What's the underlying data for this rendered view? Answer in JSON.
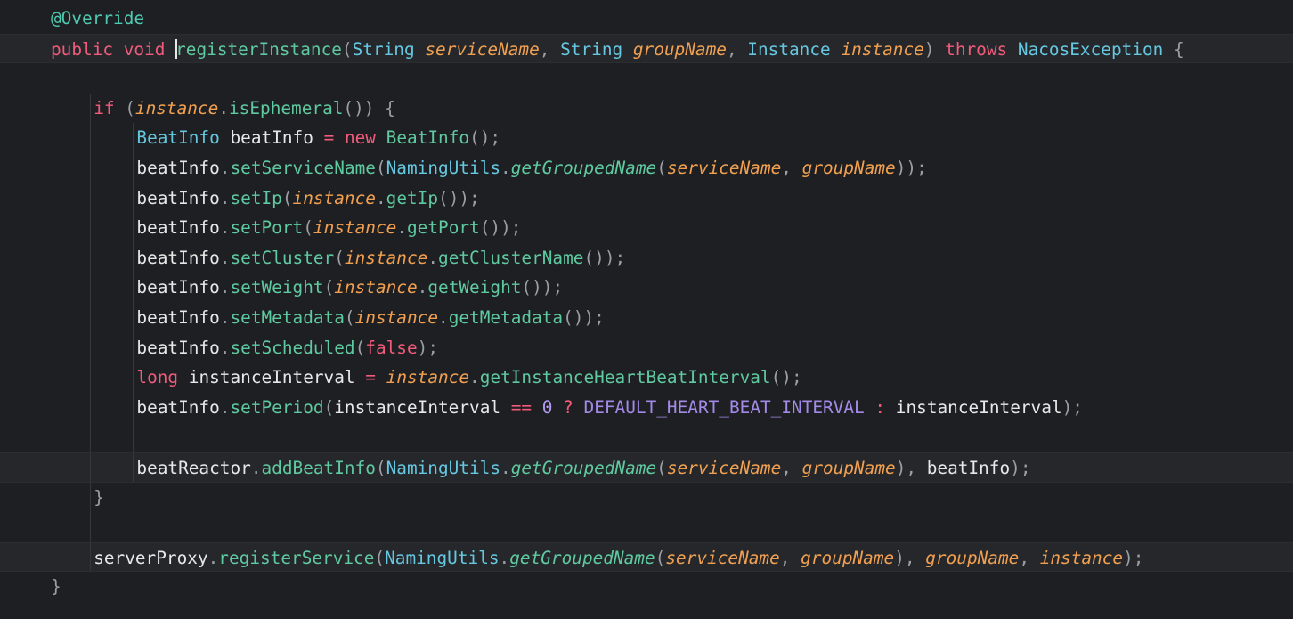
{
  "editor": {
    "language": "java",
    "lines": [
      {
        "indent": 0,
        "tokens": [
          {
            "t": "@Override",
            "c": "annot"
          }
        ]
      },
      {
        "indent": 0,
        "highlight": true,
        "caret_after_token": 4,
        "tokens": [
          {
            "t": "public",
            "c": "kw"
          },
          {
            "t": " ",
            "c": "pun"
          },
          {
            "t": "void",
            "c": "kw"
          },
          {
            "t": " ",
            "c": "pun"
          },
          {
            "t": "registerInstance",
            "c": "fn"
          },
          {
            "t": "(",
            "c": "pun"
          },
          {
            "t": "String",
            "c": "type"
          },
          {
            "t": " ",
            "c": "pun"
          },
          {
            "t": "serviceName",
            "c": "param"
          },
          {
            "t": ", ",
            "c": "pun"
          },
          {
            "t": "String",
            "c": "type"
          },
          {
            "t": " ",
            "c": "pun"
          },
          {
            "t": "groupName",
            "c": "param"
          },
          {
            "t": ", ",
            "c": "pun"
          },
          {
            "t": "Instance",
            "c": "type"
          },
          {
            "t": " ",
            "c": "pun"
          },
          {
            "t": "instance",
            "c": "param"
          },
          {
            "t": ") ",
            "c": "pun"
          },
          {
            "t": "throws",
            "c": "kw"
          },
          {
            "t": " ",
            "c": "pun"
          },
          {
            "t": "NacosException",
            "c": "type"
          },
          {
            "t": " {",
            "c": "pun"
          }
        ]
      },
      {
        "indent": 0,
        "tokens": []
      },
      {
        "indent": 1,
        "tokens": [
          {
            "t": "if",
            "c": "kw"
          },
          {
            "t": " (",
            "c": "pun"
          },
          {
            "t": "instance",
            "c": "param"
          },
          {
            "t": ".",
            "c": "pun"
          },
          {
            "t": "isEphemeral",
            "c": "fn"
          },
          {
            "t": "()) {",
            "c": "pun"
          }
        ]
      },
      {
        "indent": 2,
        "tokens": [
          {
            "t": "BeatInfo",
            "c": "type"
          },
          {
            "t": " ",
            "c": "pun"
          },
          {
            "t": "beatInfo",
            "c": "var"
          },
          {
            "t": " ",
            "c": "pun"
          },
          {
            "t": "=",
            "c": "op"
          },
          {
            "t": " ",
            "c": "pun"
          },
          {
            "t": "new",
            "c": "kw"
          },
          {
            "t": " ",
            "c": "pun"
          },
          {
            "t": "BeatInfo",
            "c": "fn"
          },
          {
            "t": "();",
            "c": "pun"
          }
        ]
      },
      {
        "indent": 2,
        "tokens": [
          {
            "t": "beatInfo",
            "c": "var"
          },
          {
            "t": ".",
            "c": "pun"
          },
          {
            "t": "setServiceName",
            "c": "fn"
          },
          {
            "t": "(",
            "c": "pun"
          },
          {
            "t": "NamingUtils",
            "c": "type"
          },
          {
            "t": ".",
            "c": "pun"
          },
          {
            "t": "getGroupedName",
            "c": "static"
          },
          {
            "t": "(",
            "c": "pun"
          },
          {
            "t": "serviceName",
            "c": "param"
          },
          {
            "t": ", ",
            "c": "pun"
          },
          {
            "t": "groupName",
            "c": "param"
          },
          {
            "t": "));",
            "c": "pun"
          }
        ]
      },
      {
        "indent": 2,
        "tokens": [
          {
            "t": "beatInfo",
            "c": "var"
          },
          {
            "t": ".",
            "c": "pun"
          },
          {
            "t": "setIp",
            "c": "fn"
          },
          {
            "t": "(",
            "c": "pun"
          },
          {
            "t": "instance",
            "c": "param"
          },
          {
            "t": ".",
            "c": "pun"
          },
          {
            "t": "getIp",
            "c": "fn"
          },
          {
            "t": "());",
            "c": "pun"
          }
        ]
      },
      {
        "indent": 2,
        "tokens": [
          {
            "t": "beatInfo",
            "c": "var"
          },
          {
            "t": ".",
            "c": "pun"
          },
          {
            "t": "setPort",
            "c": "fn"
          },
          {
            "t": "(",
            "c": "pun"
          },
          {
            "t": "instance",
            "c": "param"
          },
          {
            "t": ".",
            "c": "pun"
          },
          {
            "t": "getPort",
            "c": "fn"
          },
          {
            "t": "());",
            "c": "pun"
          }
        ]
      },
      {
        "indent": 2,
        "tokens": [
          {
            "t": "beatInfo",
            "c": "var"
          },
          {
            "t": ".",
            "c": "pun"
          },
          {
            "t": "setCluster",
            "c": "fn"
          },
          {
            "t": "(",
            "c": "pun"
          },
          {
            "t": "instance",
            "c": "param"
          },
          {
            "t": ".",
            "c": "pun"
          },
          {
            "t": "getClusterName",
            "c": "fn"
          },
          {
            "t": "());",
            "c": "pun"
          }
        ]
      },
      {
        "indent": 2,
        "tokens": [
          {
            "t": "beatInfo",
            "c": "var"
          },
          {
            "t": ".",
            "c": "pun"
          },
          {
            "t": "setWeight",
            "c": "fn"
          },
          {
            "t": "(",
            "c": "pun"
          },
          {
            "t": "instance",
            "c": "param"
          },
          {
            "t": ".",
            "c": "pun"
          },
          {
            "t": "getWeight",
            "c": "fn"
          },
          {
            "t": "());",
            "c": "pun"
          }
        ]
      },
      {
        "indent": 2,
        "tokens": [
          {
            "t": "beatInfo",
            "c": "var"
          },
          {
            "t": ".",
            "c": "pun"
          },
          {
            "t": "setMetadata",
            "c": "fn"
          },
          {
            "t": "(",
            "c": "pun"
          },
          {
            "t": "instance",
            "c": "param"
          },
          {
            "t": ".",
            "c": "pun"
          },
          {
            "t": "getMetadata",
            "c": "fn"
          },
          {
            "t": "());",
            "c": "pun"
          }
        ]
      },
      {
        "indent": 2,
        "tokens": [
          {
            "t": "beatInfo",
            "c": "var"
          },
          {
            "t": ".",
            "c": "pun"
          },
          {
            "t": "setScheduled",
            "c": "fn"
          },
          {
            "t": "(",
            "c": "pun"
          },
          {
            "t": "false",
            "c": "kw"
          },
          {
            "t": ");",
            "c": "pun"
          }
        ]
      },
      {
        "indent": 2,
        "tokens": [
          {
            "t": "long",
            "c": "kw"
          },
          {
            "t": " ",
            "c": "pun"
          },
          {
            "t": "instanceInterval",
            "c": "var"
          },
          {
            "t": " ",
            "c": "pun"
          },
          {
            "t": "=",
            "c": "op"
          },
          {
            "t": " ",
            "c": "pun"
          },
          {
            "t": "instance",
            "c": "param"
          },
          {
            "t": ".",
            "c": "pun"
          },
          {
            "t": "getInstanceHeartBeatInterval",
            "c": "fn"
          },
          {
            "t": "();",
            "c": "pun"
          }
        ]
      },
      {
        "indent": 2,
        "tokens": [
          {
            "t": "beatInfo",
            "c": "var"
          },
          {
            "t": ".",
            "c": "pun"
          },
          {
            "t": "setPeriod",
            "c": "fn"
          },
          {
            "t": "(",
            "c": "pun"
          },
          {
            "t": "instanceInterval",
            "c": "var"
          },
          {
            "t": " ",
            "c": "pun"
          },
          {
            "t": "==",
            "c": "op"
          },
          {
            "t": " ",
            "c": "pun"
          },
          {
            "t": "0",
            "c": "num"
          },
          {
            "t": " ",
            "c": "pun"
          },
          {
            "t": "?",
            "c": "op"
          },
          {
            "t": " ",
            "c": "pun"
          },
          {
            "t": "DEFAULT_HEART_BEAT_INTERVAL",
            "c": "const"
          },
          {
            "t": " ",
            "c": "pun"
          },
          {
            "t": ":",
            "c": "op"
          },
          {
            "t": " ",
            "c": "pun"
          },
          {
            "t": "instanceInterval",
            "c": "var"
          },
          {
            "t": ");",
            "c": "pun"
          }
        ]
      },
      {
        "indent": 2,
        "tokens": []
      },
      {
        "indent": 2,
        "highlight": true,
        "tokens": [
          {
            "t": "beatReactor",
            "c": "var"
          },
          {
            "t": ".",
            "c": "pun"
          },
          {
            "t": "addBeatInfo",
            "c": "fn"
          },
          {
            "t": "(",
            "c": "pun"
          },
          {
            "t": "NamingUtils",
            "c": "type"
          },
          {
            "t": ".",
            "c": "pun"
          },
          {
            "t": "getGroupedName",
            "c": "static"
          },
          {
            "t": "(",
            "c": "pun"
          },
          {
            "t": "serviceName",
            "c": "param"
          },
          {
            "t": ", ",
            "c": "pun"
          },
          {
            "t": "groupName",
            "c": "param"
          },
          {
            "t": "), ",
            "c": "pun"
          },
          {
            "t": "beatInfo",
            "c": "var"
          },
          {
            "t": ");",
            "c": "pun"
          }
        ]
      },
      {
        "indent": 1,
        "tokens": [
          {
            "t": "}",
            "c": "pun"
          }
        ]
      },
      {
        "indent": 1,
        "tokens": []
      },
      {
        "indent": 1,
        "highlight": true,
        "tokens": [
          {
            "t": "serverProxy",
            "c": "var"
          },
          {
            "t": ".",
            "c": "pun"
          },
          {
            "t": "registerService",
            "c": "fn"
          },
          {
            "t": "(",
            "c": "pun"
          },
          {
            "t": "NamingUtils",
            "c": "type"
          },
          {
            "t": ".",
            "c": "pun"
          },
          {
            "t": "getGroupedName",
            "c": "static"
          },
          {
            "t": "(",
            "c": "pun"
          },
          {
            "t": "serviceName",
            "c": "param"
          },
          {
            "t": ", ",
            "c": "pun"
          },
          {
            "t": "groupName",
            "c": "param"
          },
          {
            "t": "), ",
            "c": "pun"
          },
          {
            "t": "groupName",
            "c": "param"
          },
          {
            "t": ", ",
            "c": "pun"
          },
          {
            "t": "instance",
            "c": "param"
          },
          {
            "t": ");",
            "c": "pun"
          }
        ]
      },
      {
        "indent": 0,
        "tokens": [
          {
            "t": "}",
            "c": "pun"
          }
        ]
      }
    ]
  }
}
